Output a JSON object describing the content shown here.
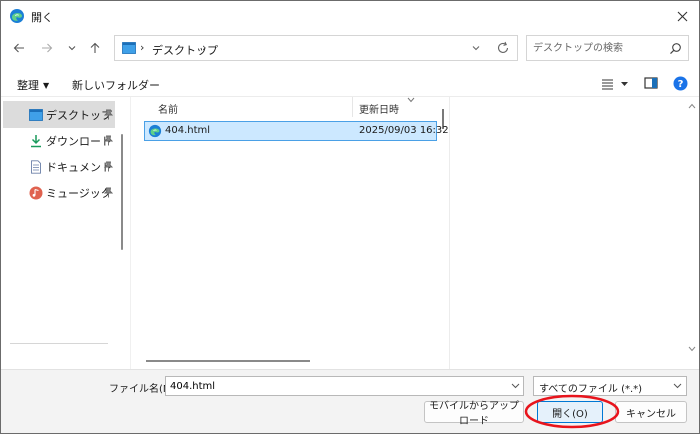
{
  "window": {
    "title": "開く",
    "app_icon": "edge-icon",
    "close_icon": "close-icon"
  },
  "address": {
    "crumb": "デスクトップ",
    "separator": "›"
  },
  "search": {
    "placeholder": "デスクトップの検索"
  },
  "toolbar": {
    "organize_label": "整理",
    "new_folder_label": "新しいフォルダー"
  },
  "sidebar": {
    "items": [
      {
        "label": "デスクトップ",
        "icon": "desktop-icon",
        "selected": true
      },
      {
        "label": "ダウンロード",
        "icon": "download-icon",
        "selected": false
      },
      {
        "label": "ドキュメント",
        "icon": "document-icon",
        "selected": false
      },
      {
        "label": "ミュージック",
        "icon": "music-icon",
        "selected": false
      }
    ]
  },
  "file_list": {
    "columns": {
      "name": "名前",
      "date": "更新日時"
    },
    "rows": [
      {
        "name": "404.html",
        "date": "2025/09/03 16:32",
        "icon": "edge-icon",
        "selected": true
      }
    ]
  },
  "bottom": {
    "file_name_label": "ファイル名(N):",
    "file_name_value": "404.html",
    "filter_label": "すべてのファイル (*.*)",
    "upload_label": "モバイルからアップロード",
    "open_label": "開く(O)",
    "cancel_label": "キャンセル"
  },
  "colors": {
    "selection_bg": "#cce8ff",
    "selection_border": "#4aa0e6",
    "accent": "#0078d4",
    "highlight_ellipse": "#e8141c",
    "help": "#1a73e8"
  }
}
